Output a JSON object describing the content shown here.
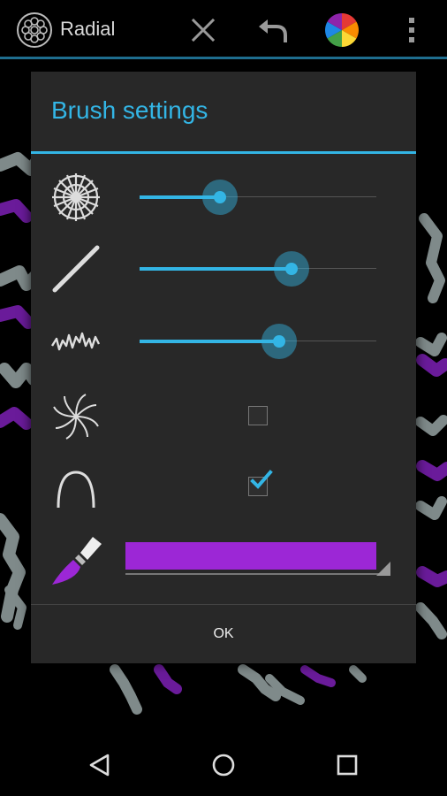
{
  "app": {
    "title": "Radial"
  },
  "actionbar": {
    "close_icon": "close-icon",
    "undo_icon": "undo-icon",
    "color_icon": "color-wheel-icon",
    "more_icon": "overflow-menu-icon"
  },
  "dialog": {
    "title": "Brush settings",
    "sliders": [
      {
        "icon": "radial-segments-icon",
        "value": 0.34
      },
      {
        "icon": "brush-width-icon",
        "value": 0.64
      },
      {
        "icon": "jitter-icon",
        "value": 0.59
      }
    ],
    "checkboxes": [
      {
        "icon": "spiral-icon",
        "checked": false
      },
      {
        "icon": "curve-icon",
        "checked": true
      }
    ],
    "color": {
      "icon": "paintbrush-icon",
      "value": "#9c27d6"
    },
    "ok_label": "OK"
  },
  "navbar": {
    "back": "back-icon",
    "home": "home-icon",
    "recent": "recent-apps-icon"
  },
  "colors": {
    "accent": "#33b5e5",
    "dialog_bg": "#282828",
    "stroke_gray": "#7f8a8a",
    "stroke_purple": "#6a1b9a"
  }
}
